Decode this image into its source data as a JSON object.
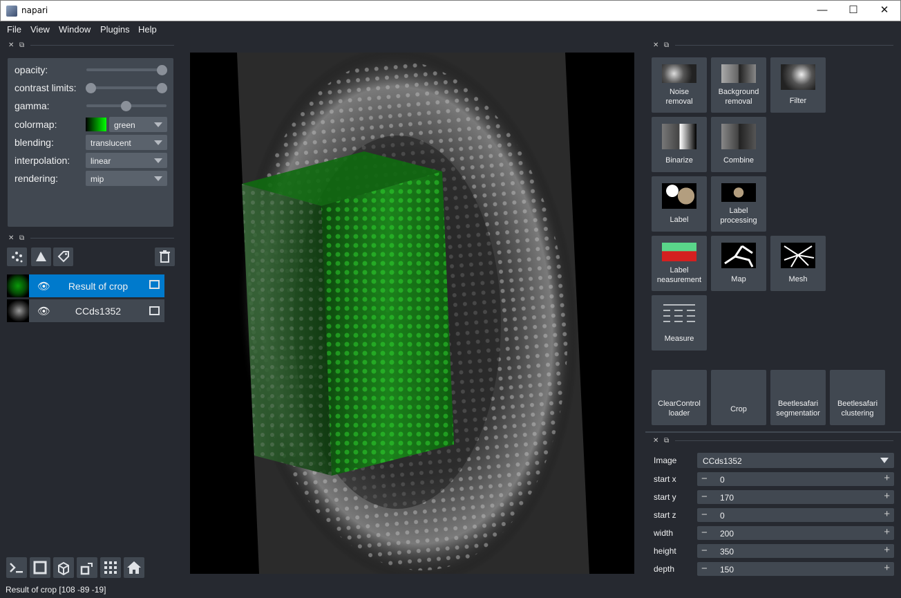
{
  "window": {
    "title": "napari",
    "minimize": "—",
    "maximize": "☐",
    "close": "✕"
  },
  "menu": [
    "File",
    "View",
    "Window",
    "Plugins",
    "Help"
  ],
  "layer_controls": {
    "opacity_label": "opacity:",
    "opacity_value": 1.0,
    "contrast_label": "contrast limits:",
    "gamma_label": "gamma:",
    "gamma_value": 0.5,
    "colormap_label": "colormap:",
    "colormap_value": "green",
    "blending_label": "blending:",
    "blending_value": "translucent",
    "interpolation_label": "interpolation:",
    "interpolation_value": "linear",
    "rendering_label": "rendering:",
    "rendering_value": "mip"
  },
  "layers": [
    {
      "name": "Result of crop",
      "selected": true
    },
    {
      "name": "CCds1352",
      "selected": false
    }
  ],
  "tools": [
    {
      "label": "Noise\nremoval",
      "l1": "Noise",
      "l2": "removal"
    },
    {
      "label": "Background removal",
      "l1": "Background",
      "l2": "removal"
    },
    {
      "label": "Filter",
      "l1": "Filter",
      "l2": ""
    },
    {
      "label": "Binarize",
      "l1": "Binarize",
      "l2": ""
    },
    {
      "label": "Combine",
      "l1": "Combine",
      "l2": ""
    },
    {
      "label": "Label",
      "l1": "Label",
      "l2": ""
    },
    {
      "label": "Label processing",
      "l1": "Label",
      "l2": "processing"
    },
    {
      "label": "Label measurement",
      "l1": "Label",
      "l2": "neasurement"
    },
    {
      "label": "Map",
      "l1": "Map",
      "l2": ""
    },
    {
      "label": "Mesh",
      "l1": "Mesh",
      "l2": ""
    },
    {
      "label": "Measure",
      "l1": "Measure",
      "l2": ""
    }
  ],
  "bottom_tools": [
    {
      "l1": "ClearControl",
      "l2": "loader"
    },
    {
      "l1": "Crop",
      "l2": ""
    },
    {
      "l1": "Beetlesafari",
      "l2": "segmentatior"
    },
    {
      "l1": "Beetlesafari",
      "l2": "clustering"
    }
  ],
  "crop_form": {
    "image_label": "Image",
    "image_value": "CCds1352",
    "fields": [
      {
        "label": "start x",
        "value": "0"
      },
      {
        "label": "start y",
        "value": "170"
      },
      {
        "label": "start z",
        "value": "0"
      },
      {
        "label": "width",
        "value": "200"
      },
      {
        "label": "height",
        "value": "350"
      },
      {
        "label": "depth",
        "value": "150"
      }
    ]
  },
  "status": "Result of crop [108 -89 -19]",
  "icons": [
    "console-icon",
    "ndisplay-icon",
    "roll-dims-icon",
    "transpose-icon",
    "grid-icon",
    "home-icon",
    "points-layer-icon",
    "shapes-layer-icon",
    "labels-layer-icon",
    "trash-icon",
    "eye-icon",
    "image-type-icon"
  ],
  "colors": {
    "bg": "#262930",
    "panel": "#414851",
    "selected": "#007acc",
    "accent_green": "#00ff00"
  }
}
